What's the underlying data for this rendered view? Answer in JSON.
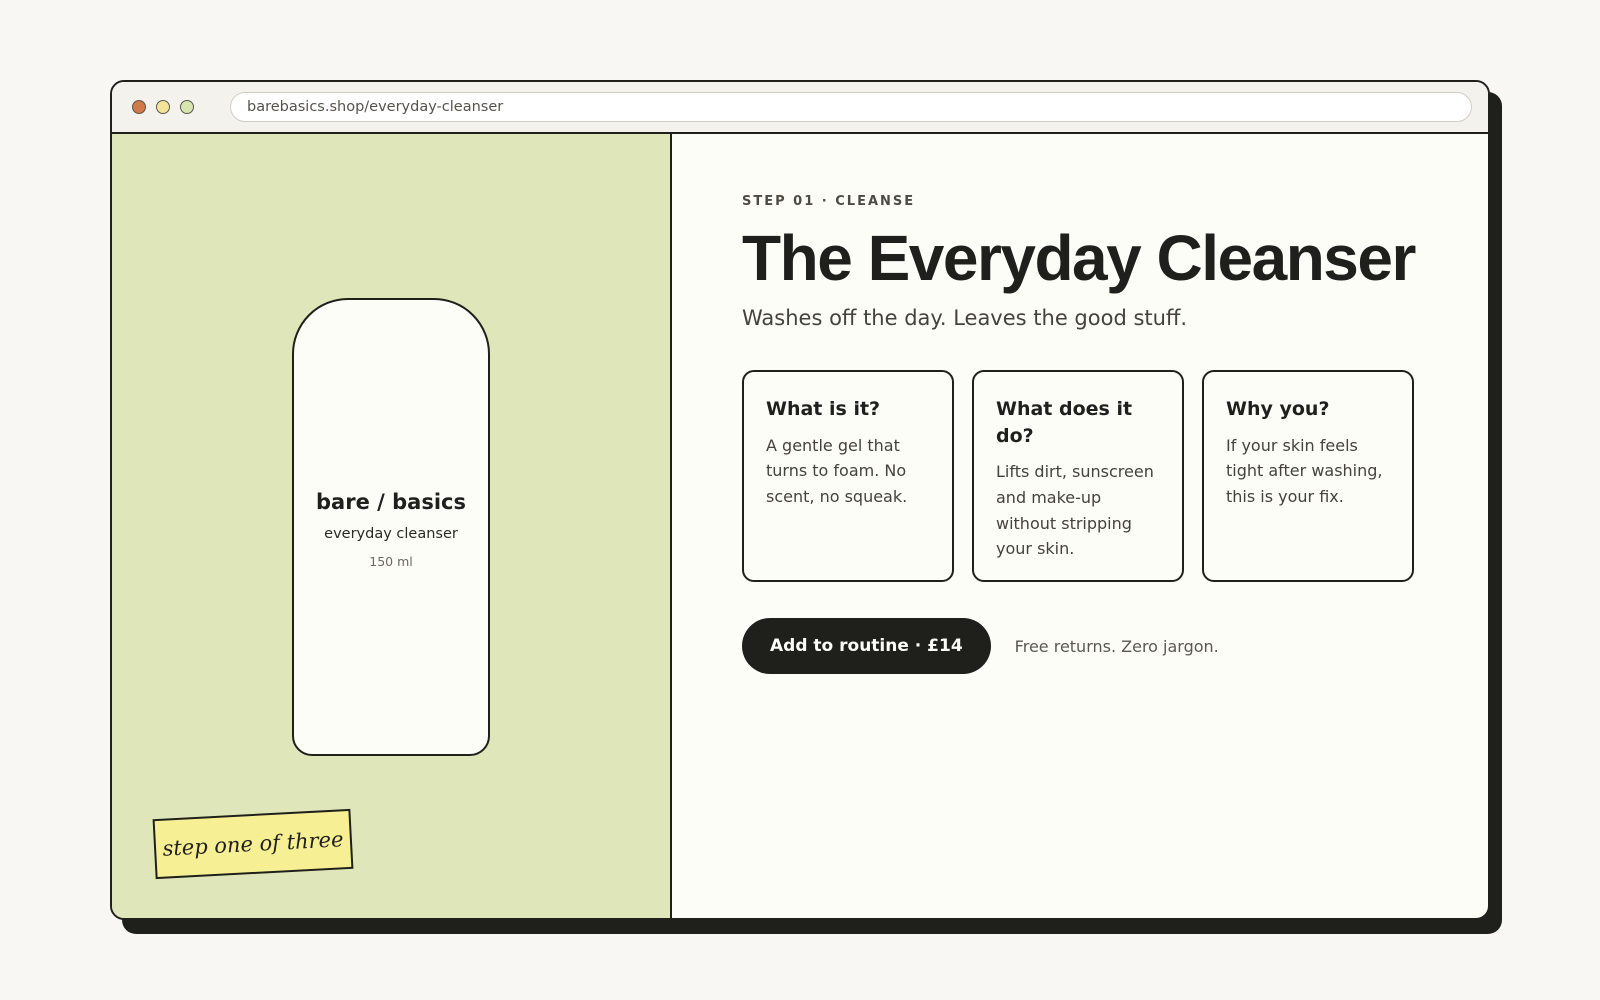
{
  "browser": {
    "url": "barebasics.shop/everyday-cleanser"
  },
  "product_visual": {
    "brand": "bare / basics",
    "name": "everyday cleanser",
    "size": "150 ml",
    "sticky_note": "step one of three"
  },
  "product": {
    "eyebrow": "STEP 01 · CLEANSE",
    "title": "The Everyday Cleanser",
    "tagline": "Washes off the day. Leaves the good stuff."
  },
  "cards": [
    {
      "title": "What is it?",
      "body": "A gentle gel that turns to foam. No scent, no squeak."
    },
    {
      "title": "What does it do?",
      "body": "Lifts dirt, sunscreen and make-up without stripping your skin."
    },
    {
      "title": "Why you?",
      "body": "If your skin feels tight after washing, this is your fix."
    }
  ],
  "cta": {
    "button_label": "Add to routine · £14",
    "note": "Free returns. Zero jargon."
  },
  "colors": {
    "page_bg": "#f8f7f3",
    "left_panel_bg": "#dfe7ba",
    "ink": "#1f1f1c",
    "sticky_note": "#f7ef93",
    "dot_red": "#d07a4a",
    "dot_yellow": "#f3e49a",
    "dot_green": "#d6e6b0"
  }
}
